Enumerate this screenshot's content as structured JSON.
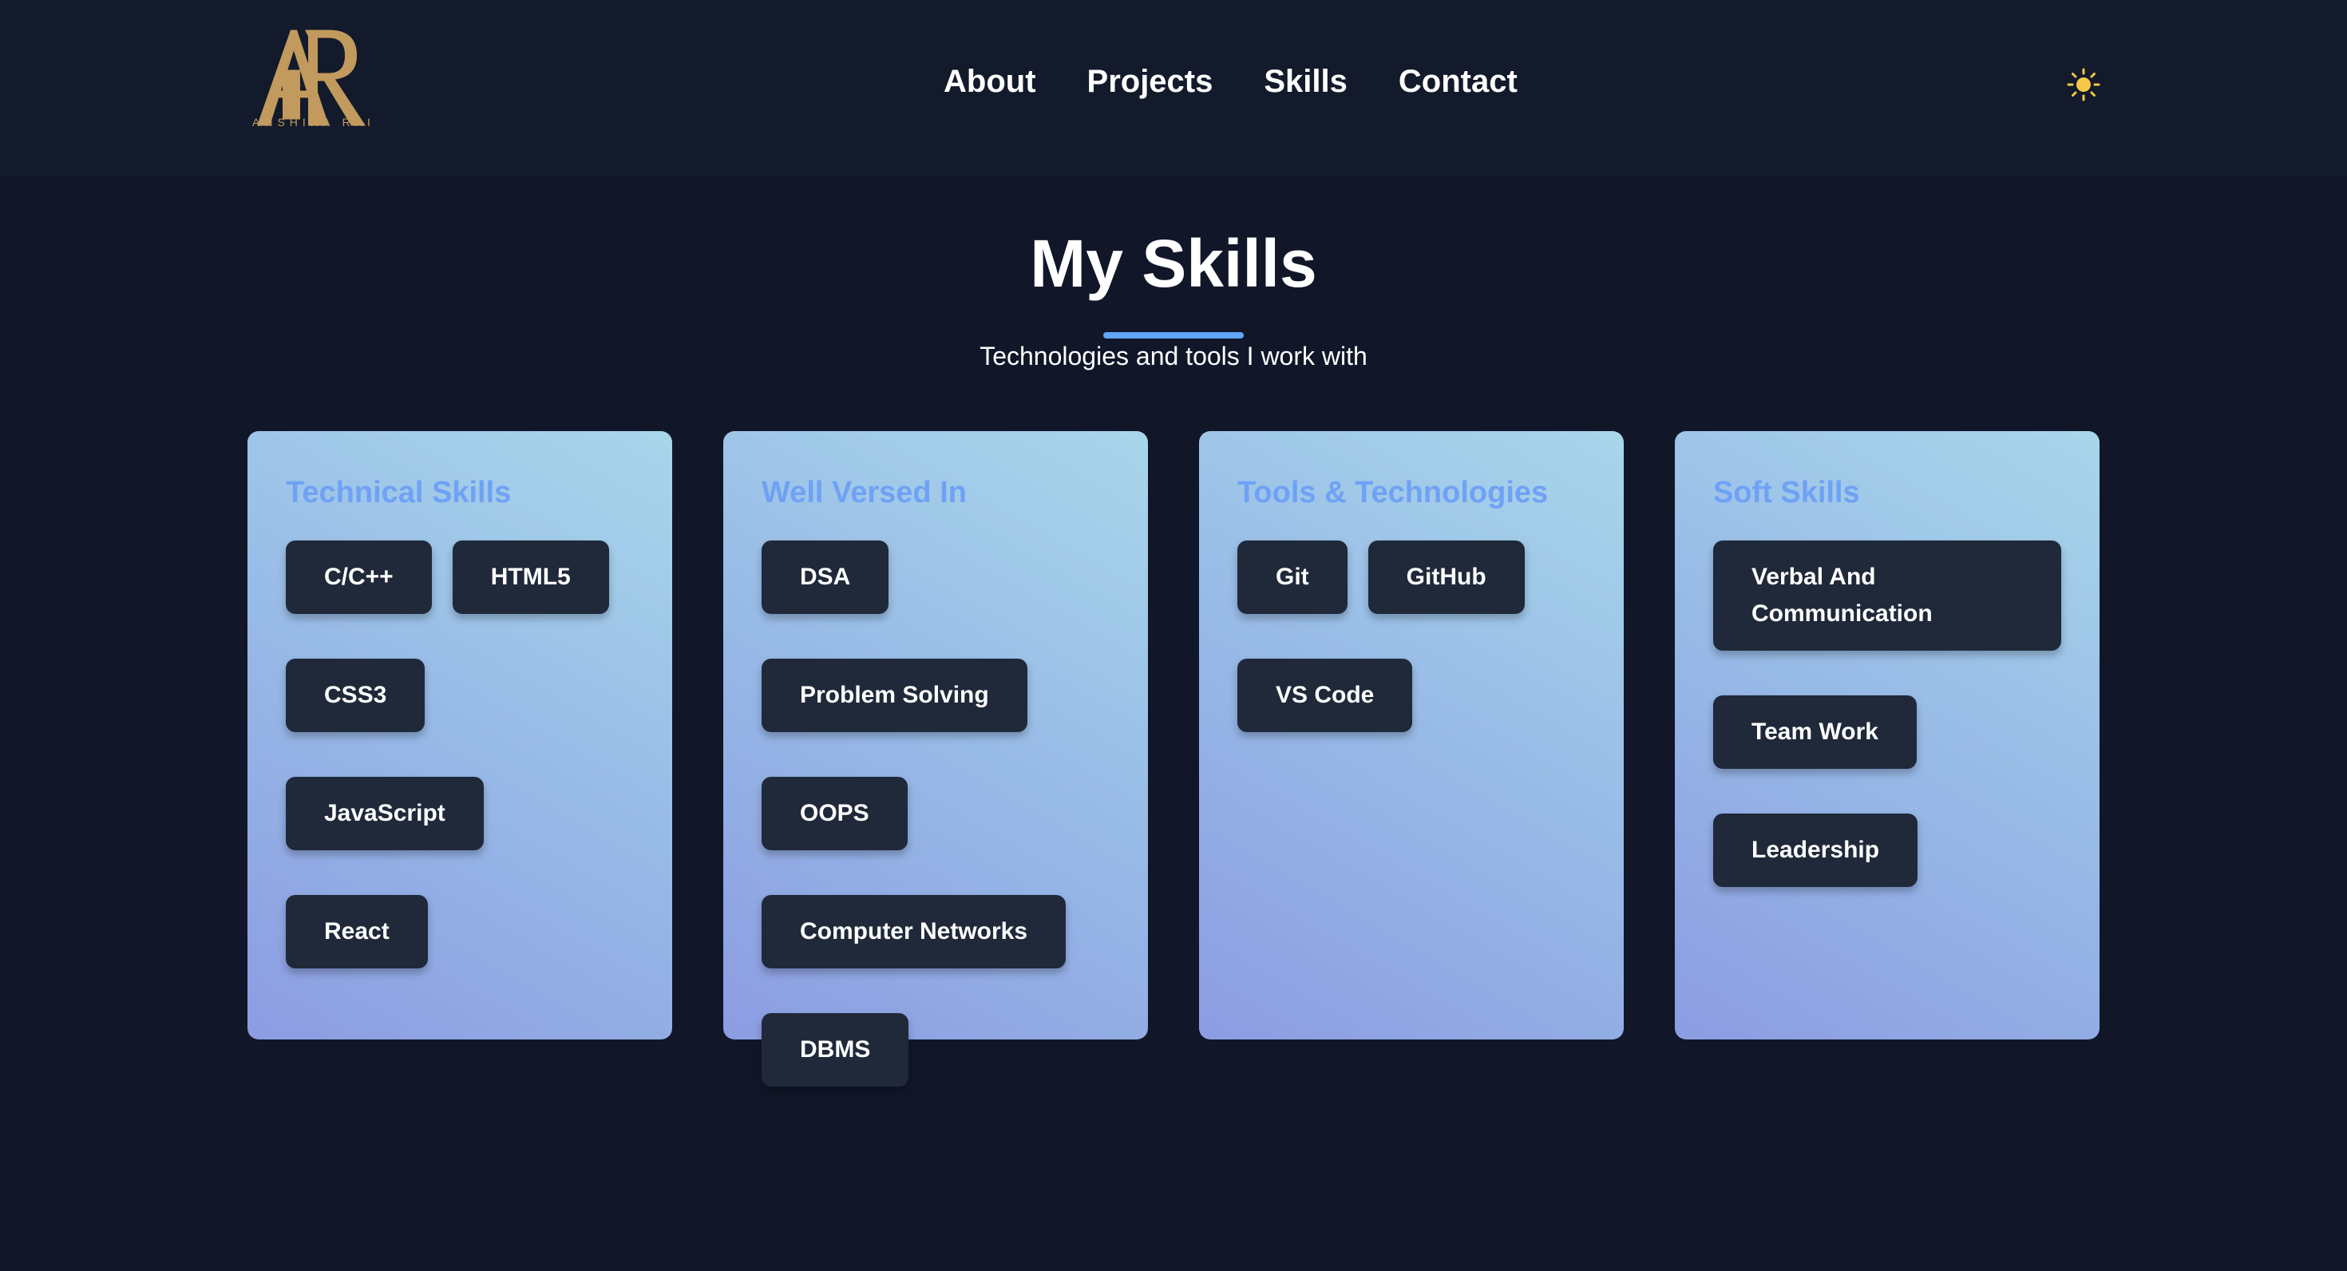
{
  "header": {
    "logo_caption": "ANSHIKA RAI",
    "logo_letters": "AR",
    "nav": [
      "About",
      "Projects",
      "Skills",
      "Contact"
    ],
    "theme_toggle_icon": "sun-icon"
  },
  "section": {
    "title": "My Skills",
    "subtitle": "Technologies and tools I work with"
  },
  "cards": [
    {
      "title": "Technical Skills",
      "skills": [
        "C/C++",
        "HTML5",
        "CSS3",
        "JavaScript",
        "React"
      ]
    },
    {
      "title": "Well Versed In",
      "skills": [
        "DSA",
        "Problem Solving",
        "OOPS",
        "Computer Networks",
        "DBMS"
      ]
    },
    {
      "title": "Tools & Technologies",
      "skills": [
        "Git",
        "GitHub",
        "VS Code"
      ]
    },
    {
      "title": "Soft Skills",
      "skills": [
        "Verbal And Communication",
        "Team Work",
        "Leadership"
      ]
    }
  ],
  "colors": {
    "background": "#111729",
    "header": "#131a2b",
    "accent": "#60a5fa",
    "card_title": "#6fa1f5",
    "chip": "#1f293a",
    "logo_gold": "#c29a5e"
  }
}
